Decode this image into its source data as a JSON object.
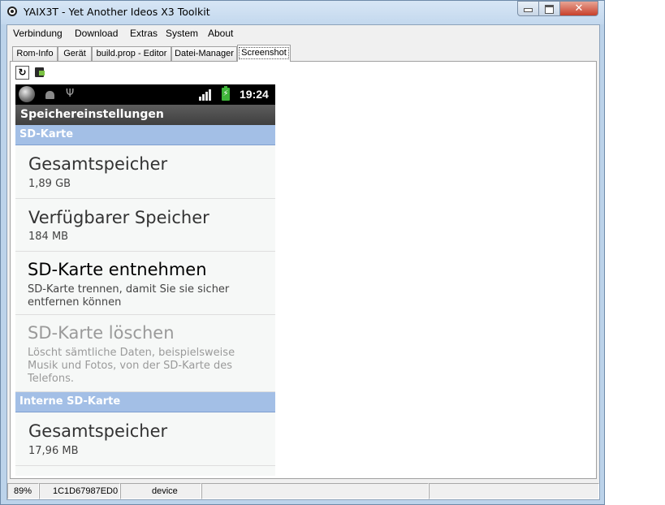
{
  "window": {
    "title": "YAIX3T - Yet Another Ideos X3 Toolkit",
    "close_glyph": "✕"
  },
  "menu": [
    "Verbindung",
    "Download",
    "Extras",
    "System",
    "About"
  ],
  "tabs": [
    "Rom-Info",
    "Gerät",
    "build.prop - Editor",
    "Datei-Manager",
    "Screenshot"
  ],
  "active_tab": "Screenshot",
  "toolbar": {
    "refresh_icon": "refresh-icon",
    "save_icon": "save-screenshot-icon",
    "refresh_glyph": "↻"
  },
  "phone": {
    "status_time": "19:24",
    "battery_glyph": "⚡",
    "usb_glyph": "Ψ",
    "screen_title": "Speichereinstellungen",
    "sections": {
      "sd": "SD-Karte",
      "internal": "Interne SD-Karte"
    },
    "items": [
      {
        "title": "Gesamtspeicher",
        "subtitle": "1,89 GB"
      },
      {
        "title": "Verfügbarer Speicher",
        "subtitle": "184 MB"
      },
      {
        "title": "SD-Karte entnehmen",
        "subtitle": "SD-Karte trennen, damit Sie sie sicher entfernen können"
      },
      {
        "title": "SD-Karte löschen",
        "subtitle": "Löscht sämtliche Daten, beispielsweise Musik und Fotos, von der SD-Karte des Telefons."
      },
      {
        "title": "Gesamtspeicher",
        "subtitle": "17,96 MB"
      }
    ]
  },
  "statusbar": {
    "zoom": "89%",
    "serial": "1C1D67987ED0",
    "state": "device"
  }
}
